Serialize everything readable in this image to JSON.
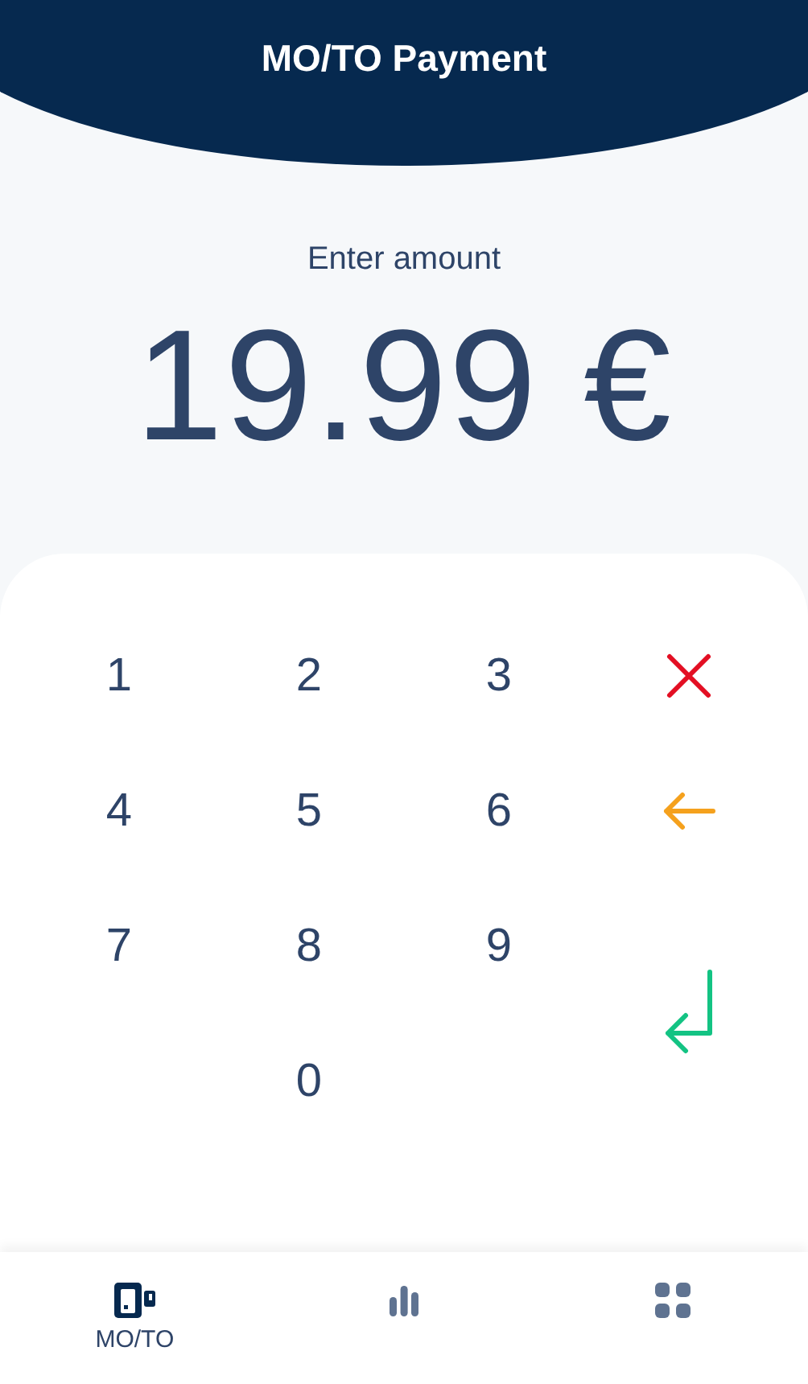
{
  "header": {
    "title": "MO/TO Payment"
  },
  "amount": {
    "label": "Enter amount",
    "value": "19.99 €"
  },
  "keypad": [
    {
      "kind": "digit",
      "label": "1"
    },
    {
      "kind": "digit",
      "label": "2"
    },
    {
      "kind": "digit",
      "label": "3"
    },
    {
      "kind": "cancel"
    },
    {
      "kind": "digit",
      "label": "4"
    },
    {
      "kind": "digit",
      "label": "5"
    },
    {
      "kind": "digit",
      "label": "6"
    },
    {
      "kind": "backspace"
    },
    {
      "kind": "digit",
      "label": "7"
    },
    {
      "kind": "digit",
      "label": "8"
    },
    {
      "kind": "digit",
      "label": "9"
    },
    {
      "kind": "enter"
    },
    {
      "kind": "digit",
      "label": "0"
    }
  ],
  "nav": [
    {
      "kind": "terminal",
      "label": "MO/TO",
      "selected": true
    },
    {
      "kind": "chart",
      "selected": false
    },
    {
      "kind": "grid",
      "selected": false
    }
  ]
}
